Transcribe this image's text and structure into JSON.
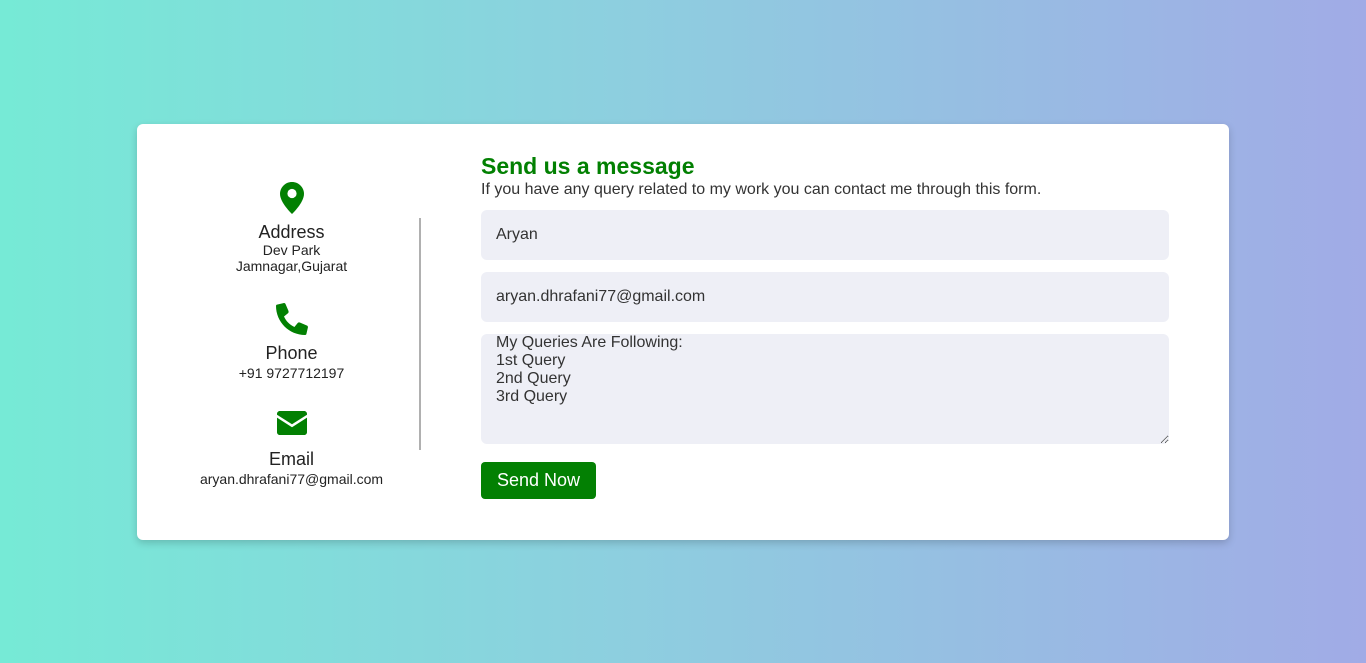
{
  "contact_info": {
    "address": {
      "icon": "map-marker-icon",
      "topic": "Address",
      "line1": "Dev Park",
      "line2": "Jamnagar,Gujarat"
    },
    "phone": {
      "icon": "phone-icon",
      "topic": "Phone",
      "number": "+91 9727712197"
    },
    "email": {
      "icon": "envelope-icon",
      "topic": "Email",
      "address": "aryan.dhrafani77@gmail.com"
    }
  },
  "form": {
    "title": "Send us a message",
    "subtitle": "If you have any query related to my work you can contact me through this form.",
    "name_value": "Aryan",
    "email_value": "aryan.dhrafani77@gmail.com",
    "message_value": "My Queries Are Following:\n1st Query\n2nd Query\n3rd Query",
    "send_label": "Send Now"
  },
  "colors": {
    "accent": "#028002",
    "button": "#038003",
    "field_bg": "#eeeff6",
    "gradient_start": "#76ead6",
    "gradient_end": "#a1abe6"
  }
}
